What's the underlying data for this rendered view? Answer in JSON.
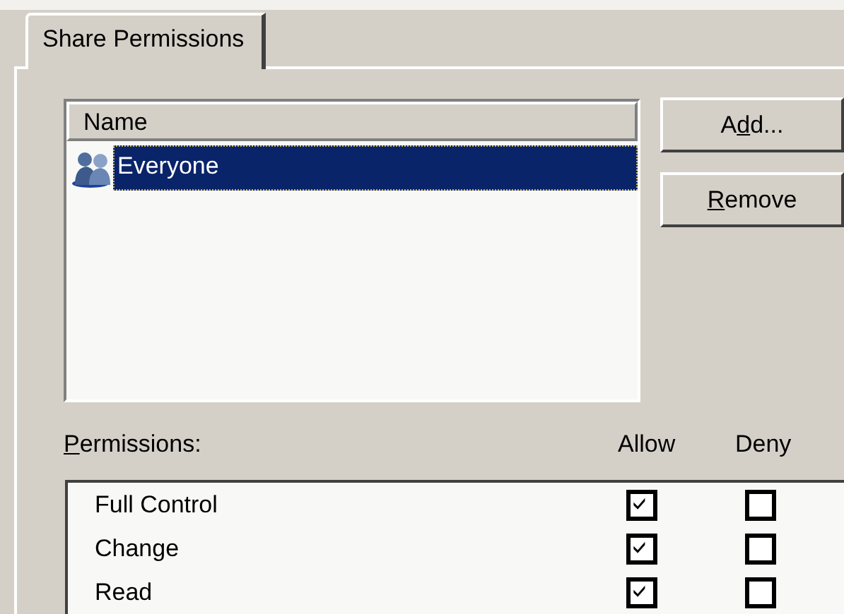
{
  "tab": {
    "label": "Share Permissions",
    "selected": true
  },
  "names_list": {
    "column": "Name",
    "items": [
      {
        "label": "Everyone",
        "selected": true
      }
    ]
  },
  "buttons": [
    {
      "before": "A",
      "key": "d",
      "after": "d..."
    },
    {
      "key": "R",
      "after": "emove"
    }
  ],
  "permissions": {
    "label": {
      "key": "P",
      "after": "ermissions:"
    },
    "columns": [
      "Allow",
      "Deny"
    ],
    "rows": [
      {
        "name": "Full Control",
        "allow": true,
        "deny": false
      },
      {
        "name": "Change",
        "allow": true,
        "deny": false
      },
      {
        "name": "Read",
        "allow": true,
        "deny": false
      }
    ]
  }
}
